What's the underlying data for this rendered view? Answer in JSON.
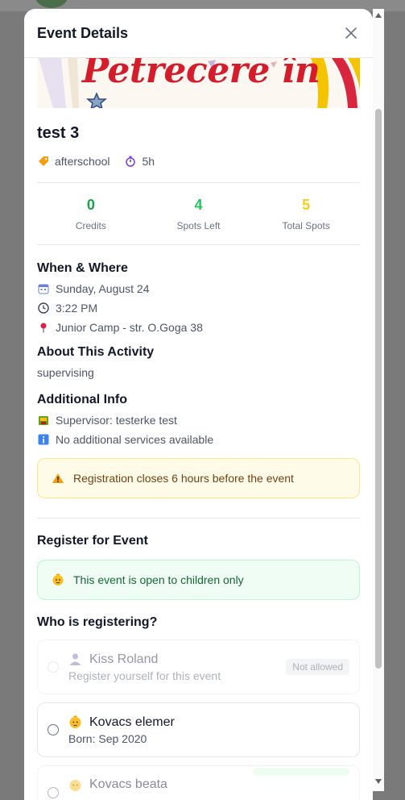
{
  "modal": {
    "title": "Event Details"
  },
  "banner": {
    "text": "Petrecere în"
  },
  "event": {
    "title": "test 3",
    "category": "afterschool",
    "duration": "5h"
  },
  "stats": [
    {
      "value": "0",
      "label": "Credits",
      "color": "#16a34a"
    },
    {
      "value": "4",
      "label": "Spots Left",
      "color": "#22c55e"
    },
    {
      "value": "5",
      "label": "Total Spots",
      "color": "#facc15"
    }
  ],
  "when_where": {
    "title": "When & Where",
    "date": "Sunday, August 24",
    "time": "3:22 PM",
    "location": "Junior Camp - str. O.Goga 38"
  },
  "about": {
    "title": "About This Activity",
    "text": "supervising"
  },
  "additional": {
    "title": "Additional Info",
    "supervisor": "Supervisor: testerke test",
    "services": "No additional services available"
  },
  "warning": {
    "text": "Registration closes 6 hours before the event"
  },
  "register": {
    "title": "Register for Event",
    "notice": "This event is open to children only",
    "who_title": "Who is registering?",
    "options": [
      {
        "name": "Kiss Roland",
        "sub": "Register yourself for this event",
        "badge": "Not allowed"
      },
      {
        "name": "Kovacs elemer",
        "sub": "Born: Sep 2020"
      },
      {
        "name": "Kovacs beata"
      }
    ]
  },
  "icons": {
    "close": "close-icon",
    "tag": "tag-icon",
    "timer": "stopwatch-icon",
    "calendar": "calendar-icon",
    "clock": "clock-icon",
    "pin": "location-pin-icon",
    "supervisor": "supervisor-icon",
    "info": "info-icon",
    "warning": "warning-icon",
    "child": "child-icon",
    "adult": "person-icon"
  }
}
